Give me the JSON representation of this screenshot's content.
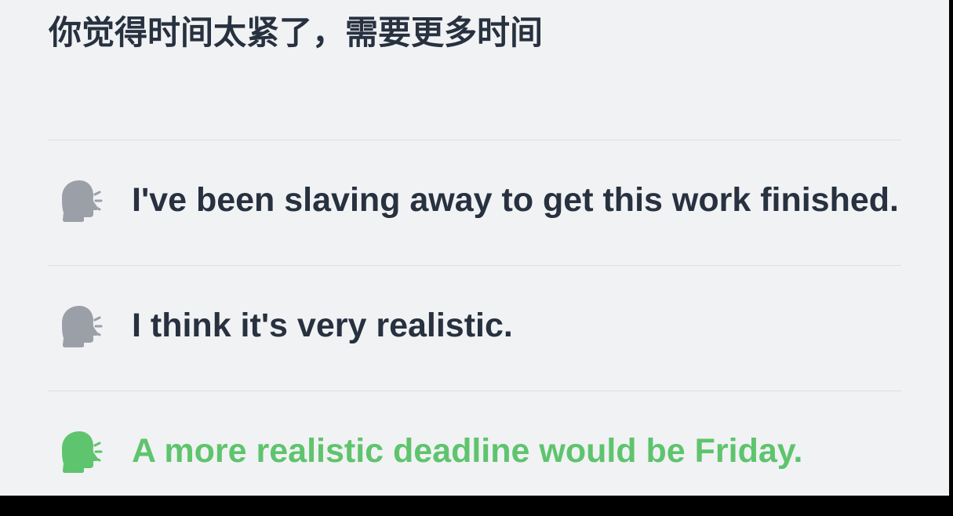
{
  "prompt": {
    "text": "你觉得时间太紧了，需要更多时间"
  },
  "options": [
    {
      "icon": "speaking-head-icon",
      "text": "I've been slaving away to get this work finished.",
      "state": "default",
      "icon_color": "#9ba0a8"
    },
    {
      "icon": "speaking-head-icon",
      "text": "I think it's very realistic.",
      "state": "default",
      "icon_color": "#9ba0a8"
    },
    {
      "icon": "speaking-head-icon",
      "text": "A more realistic deadline would be Friday.",
      "state": "correct",
      "icon_color": "#5ec46d"
    }
  ],
  "colors": {
    "background": "#f1f2f4",
    "text": "#27313f",
    "correct": "#5ec46d",
    "divider": "#dcdee3",
    "icon_default": "#9ba0a8"
  }
}
